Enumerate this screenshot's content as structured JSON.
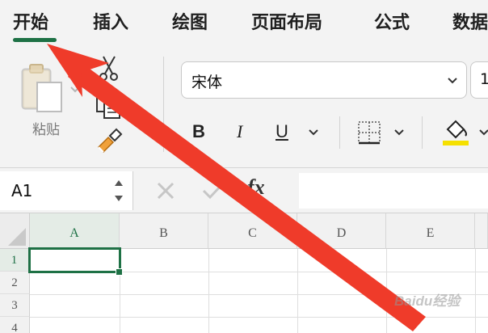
{
  "menu": {
    "tabs": [
      {
        "label": "开始"
      },
      {
        "label": "插入"
      },
      {
        "label": "绘图"
      },
      {
        "label": "页面布局"
      },
      {
        "label": "公式"
      },
      {
        "label": "数据"
      }
    ],
    "active_tab_color": "#1e7145"
  },
  "ribbon": {
    "paste_label": "粘贴",
    "font_name": "宋体",
    "font_size": "1",
    "bold_label": "B",
    "italic_label": "I",
    "underline_label": "U",
    "icons": [
      "clipboard-icon",
      "scissors-icon",
      "copy-icon",
      "format-painter-icon",
      "borders-icon",
      "fill-color-icon"
    ],
    "fill_color_swatch": "#f5e000"
  },
  "formula_bar": {
    "name_box_value": "A1",
    "fx_label": "fx"
  },
  "grid": {
    "columns": [
      "A",
      "B",
      "C",
      "D",
      "E"
    ],
    "rows": [
      "1",
      "2",
      "3",
      "4"
    ],
    "selected_cell": "A1"
  },
  "annotation": {
    "arrow_color": "#ef3b2a"
  },
  "watermark": "Baidu经验"
}
